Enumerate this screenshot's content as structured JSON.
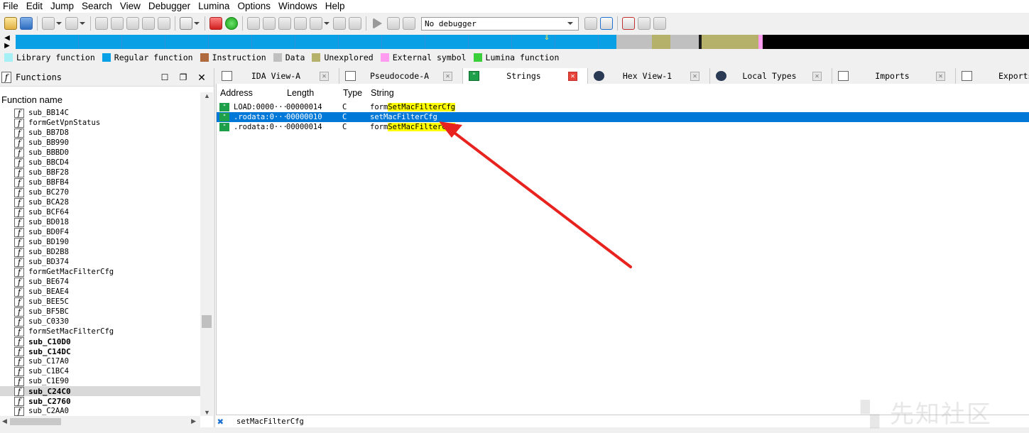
{
  "menu": [
    "File",
    "Edit",
    "Jump",
    "Search",
    "View",
    "Debugger",
    "Lumina",
    "Options",
    "Windows",
    "Help"
  ],
  "toolbar": {
    "debugger_select": "No debugger"
  },
  "legend": [
    {
      "label": "Library function",
      "color": "#a6f0f5"
    },
    {
      "label": "Regular function",
      "color": "#0aa0e6"
    },
    {
      "label": "Instruction",
      "color": "#b06a40"
    },
    {
      "label": "Data",
      "color": "#c0c0c0"
    },
    {
      "label": "Unexplored",
      "color": "#b5b06a"
    },
    {
      "label": "External symbol",
      "color": "#ff9cf0"
    },
    {
      "label": "Lumina function",
      "color": "#3ccf3c"
    }
  ],
  "functions_panel": {
    "title": "Functions",
    "column_header": "Function name",
    "items": [
      {
        "name": "sub_BB14C",
        "bold": false
      },
      {
        "name": "formGetVpnStatus",
        "bold": false
      },
      {
        "name": "sub_BB7D8",
        "bold": false
      },
      {
        "name": "sub_BB990",
        "bold": false
      },
      {
        "name": "sub_BBBD0",
        "bold": false
      },
      {
        "name": "sub_BBCD4",
        "bold": false
      },
      {
        "name": "sub_BBF28",
        "bold": false
      },
      {
        "name": "sub_BBFB4",
        "bold": false
      },
      {
        "name": "sub_BC270",
        "bold": false
      },
      {
        "name": "sub_BCA28",
        "bold": false
      },
      {
        "name": "sub_BCF64",
        "bold": false
      },
      {
        "name": "sub_BD018",
        "bold": false
      },
      {
        "name": "sub_BD0F4",
        "bold": false
      },
      {
        "name": "sub_BD190",
        "bold": false
      },
      {
        "name": "sub_BD2B8",
        "bold": false
      },
      {
        "name": "sub_BD374",
        "bold": false
      },
      {
        "name": "formGetMacFilterCfg",
        "bold": false
      },
      {
        "name": "sub_BE674",
        "bold": false
      },
      {
        "name": "sub_BEAE4",
        "bold": false
      },
      {
        "name": "sub_BEE5C",
        "bold": false
      },
      {
        "name": "sub_BF5BC",
        "bold": false
      },
      {
        "name": "sub_C0330",
        "bold": false
      },
      {
        "name": "formSetMacFilterCfg",
        "bold": false
      },
      {
        "name": "sub_C10D0",
        "bold": true
      },
      {
        "name": "sub_C14DC",
        "bold": true
      },
      {
        "name": "sub_C17A0",
        "bold": false
      },
      {
        "name": "sub_C1BC4",
        "bold": false
      },
      {
        "name": "sub_C1E90",
        "bold": false
      },
      {
        "name": "sub_C24C0",
        "bold": true,
        "selected": true
      },
      {
        "name": "sub_C2760",
        "bold": true
      },
      {
        "name": "sub_C2AA0",
        "bold": false
      }
    ]
  },
  "tabs": [
    {
      "label": "IDA View-A",
      "icon": "ida-view-icon",
      "active": false
    },
    {
      "label": "Pseudocode-A",
      "icon": "pseudocode-icon",
      "active": false
    },
    {
      "label": "Strings",
      "icon": "strings-icon",
      "active": true
    },
    {
      "label": "Hex View-1",
      "icon": "hex-view-icon",
      "active": false
    },
    {
      "label": "Local Types",
      "icon": "local-types-icon",
      "active": false
    },
    {
      "label": "Imports",
      "icon": "imports-icon",
      "active": false
    },
    {
      "label": "Exports",
      "icon": "exports-icon",
      "active": false
    }
  ],
  "strings_view": {
    "columns": [
      "Address",
      "Length",
      "Type",
      "String"
    ],
    "rows": [
      {
        "address": "LOAD:0000···",
        "length": "00000014",
        "type": "C",
        "prefix": "form",
        "match": "SetMacFilterCfg",
        "suffix": "",
        "selected": false
      },
      {
        "address": ".rodata:0···",
        "length": "00000010",
        "type": "C",
        "prefix": "",
        "match": "setMacFilterCfg",
        "suffix": "",
        "selected": true
      },
      {
        "address": ".rodata:0···",
        "length": "00000014",
        "type": "C",
        "prefix": "form",
        "match": "SetMacFilterCfg",
        "suffix": "",
        "selected": false
      }
    ]
  },
  "find_bar": {
    "value": "setMacFilterCfg"
  },
  "colors": {
    "selection": "#0078d7",
    "highlight": "#ffff00",
    "annotation_arrow": "#e8231f"
  }
}
